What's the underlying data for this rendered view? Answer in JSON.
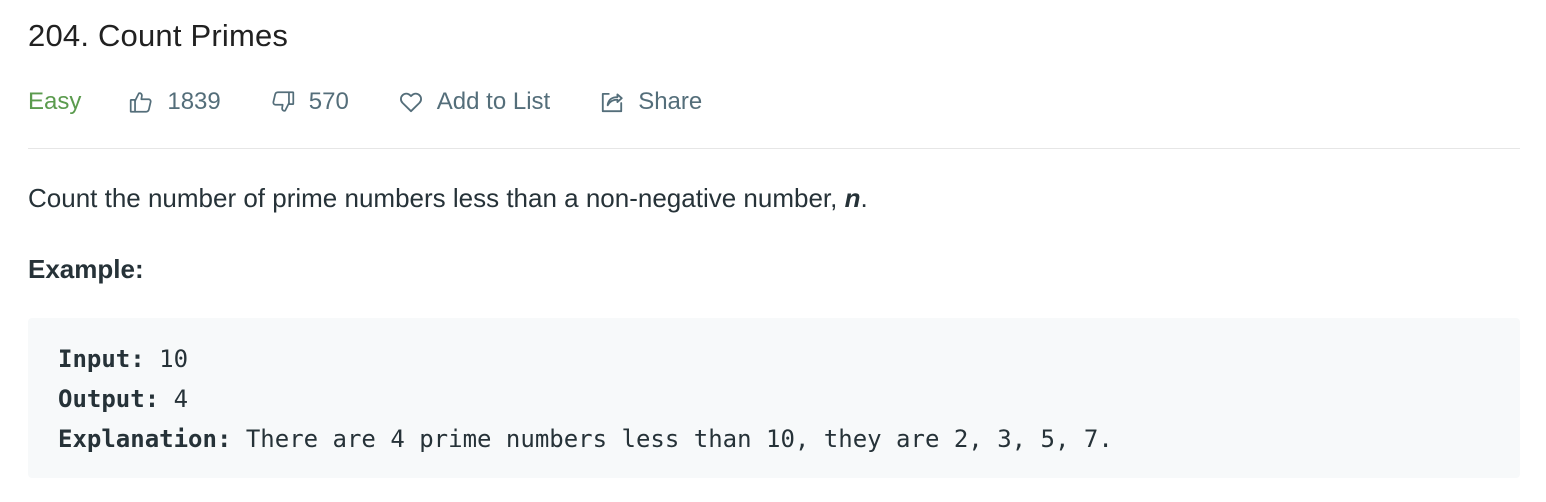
{
  "problem": {
    "title": "204. Count Primes",
    "difficulty": "Easy",
    "likes": "1839",
    "dislikes": "570",
    "add_to_list_label": "Add to List",
    "share_label": "Share"
  },
  "description": {
    "text": "Count the number of prime numbers less than a non-negative number, ",
    "variable": "n",
    "suffix": "."
  },
  "example": {
    "heading": "Example:",
    "lines": [
      {
        "key": "Input:",
        "value": " 10"
      },
      {
        "key": "Output:",
        "value": " 4"
      },
      {
        "key": "Explanation:",
        "value": " There are 4 prime numbers less than 10, they are 2, 3, 5, 7."
      }
    ]
  },
  "colors": {
    "difficulty_easy": "#5b9b4e",
    "meta_text": "#546e7a",
    "code_background": "#f7f9fa"
  },
  "icons": {
    "like": "thumbs-up-icon",
    "dislike": "thumbs-down-icon",
    "add_to_list": "heart-icon",
    "share": "share-icon"
  }
}
